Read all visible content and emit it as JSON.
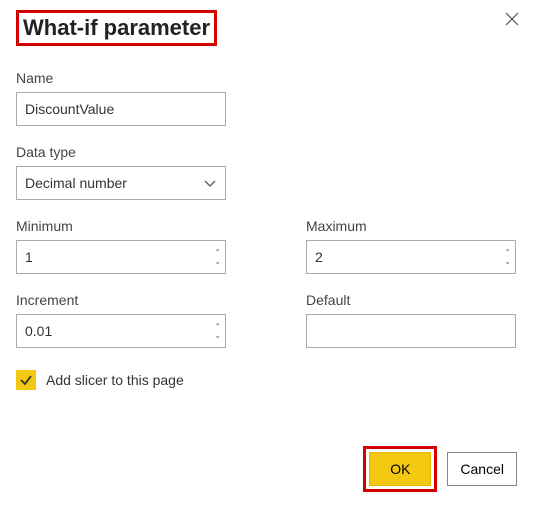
{
  "dialog": {
    "title": "What-if parameter"
  },
  "fields": {
    "name": {
      "label": "Name",
      "value": "DiscountValue"
    },
    "dataType": {
      "label": "Data type",
      "value": "Decimal number"
    },
    "minimum": {
      "label": "Minimum",
      "value": "1"
    },
    "maximum": {
      "label": "Maximum",
      "value": "2"
    },
    "increment": {
      "label": "Increment",
      "value": "0.01"
    },
    "default": {
      "label": "Default",
      "value": ""
    }
  },
  "checkbox": {
    "label": "Add slicer to this page",
    "checked": true
  },
  "buttons": {
    "ok": "OK",
    "cancel": "Cancel"
  }
}
